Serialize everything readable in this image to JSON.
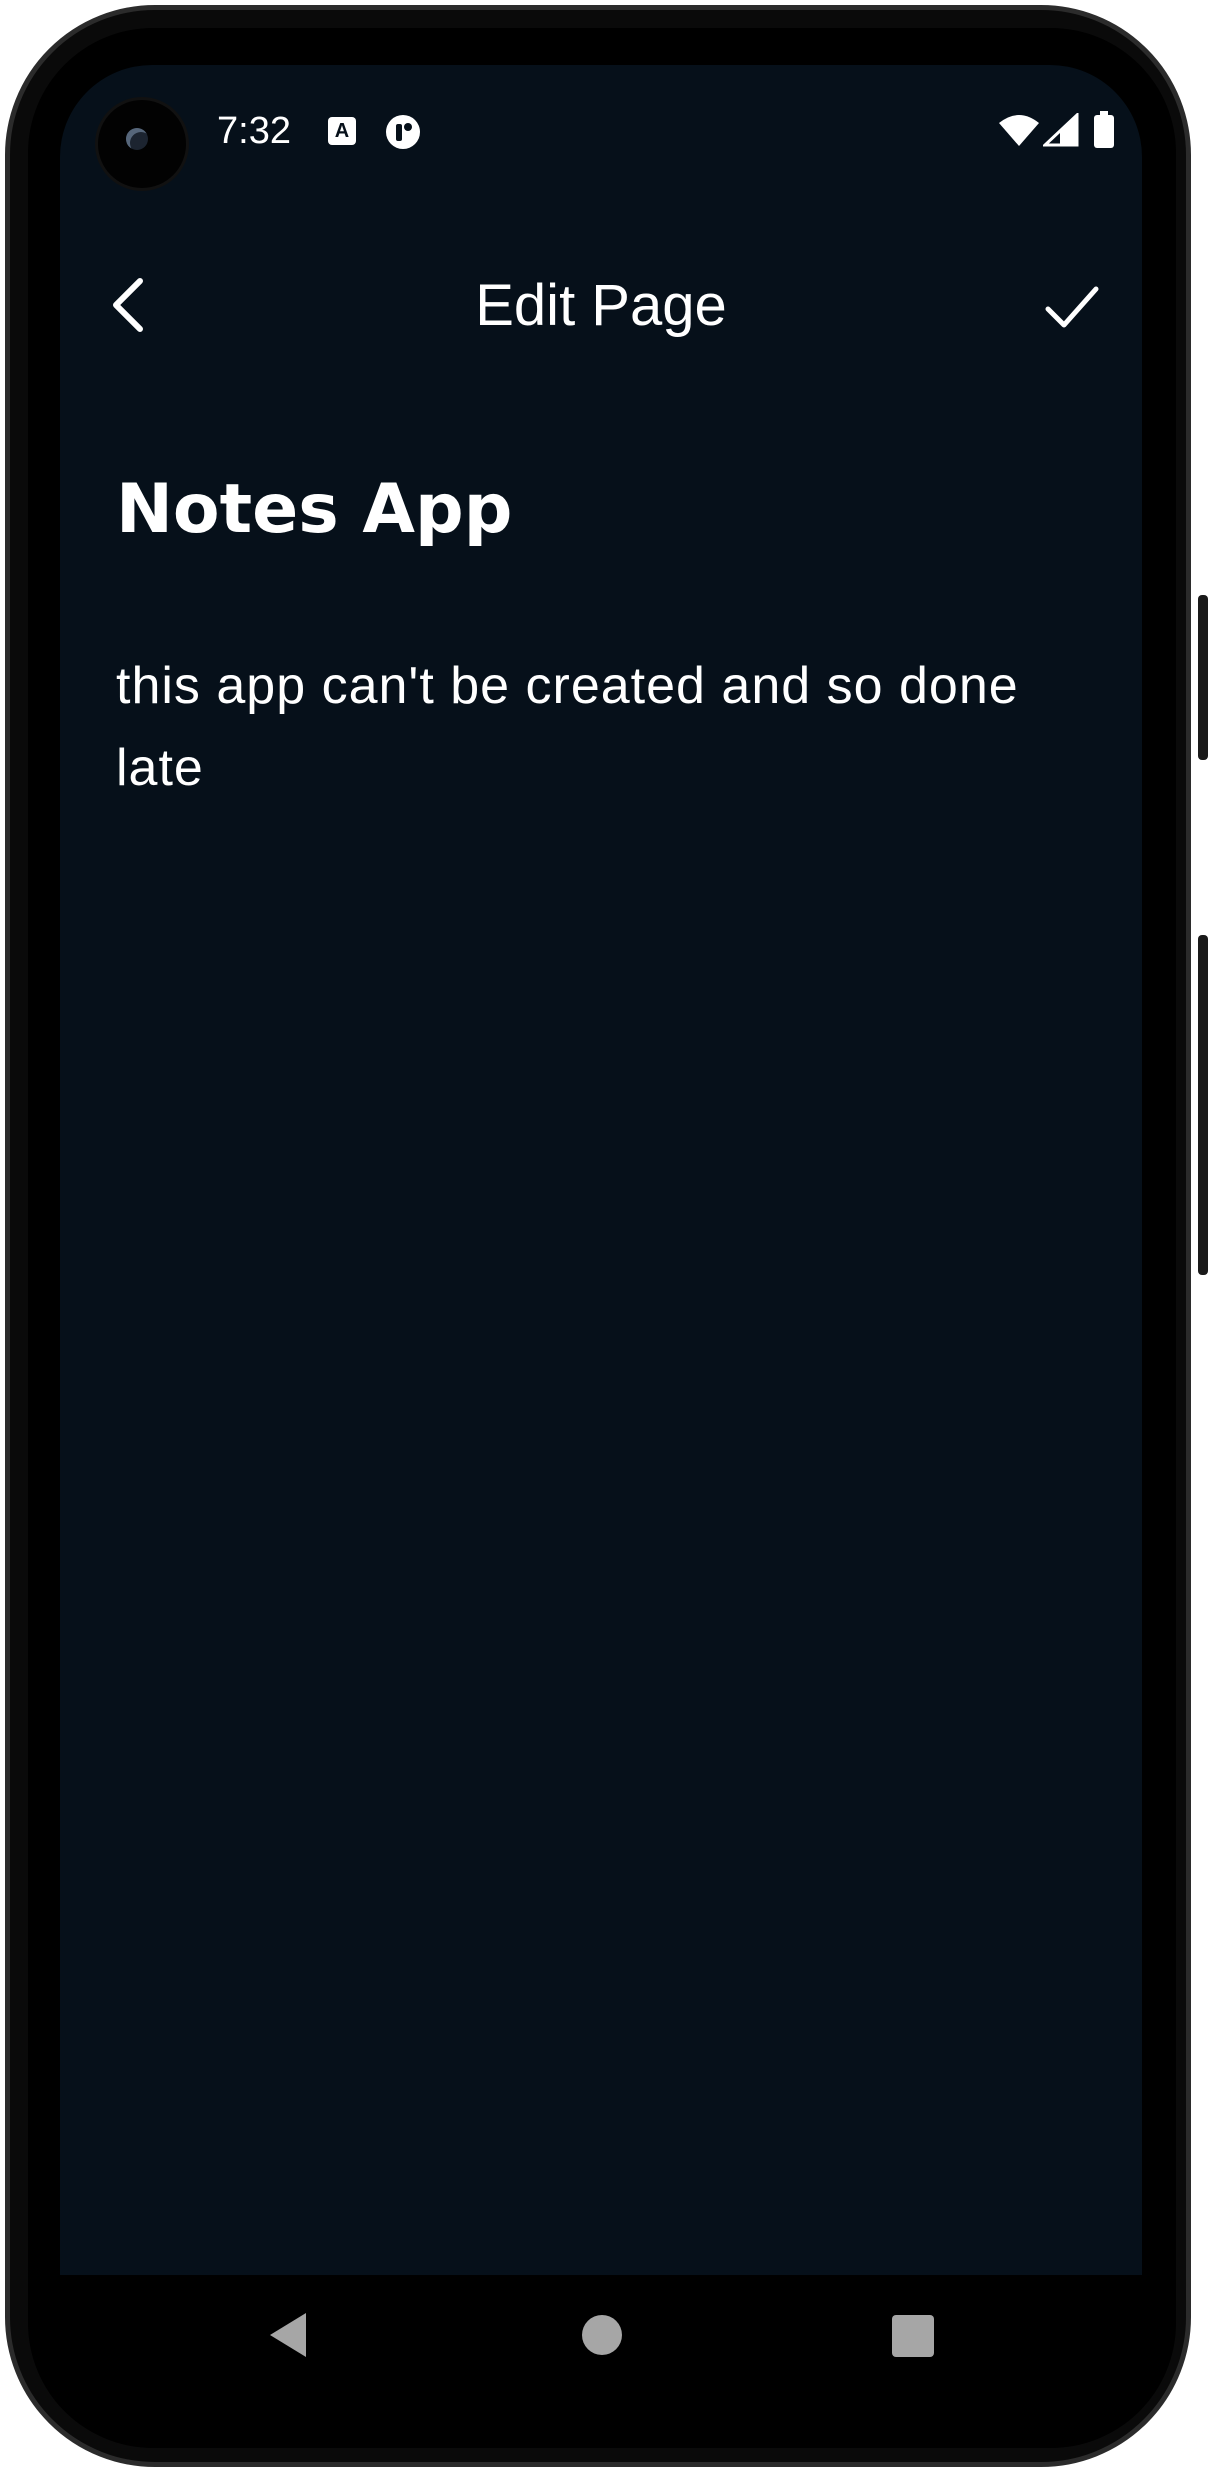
{
  "status_bar": {
    "time": "7:32",
    "notification_icons": [
      "a-badge-icon",
      "app-notification-icon"
    ],
    "system_icons": [
      "wifi-icon",
      "signal-icon",
      "battery-icon"
    ]
  },
  "app_bar": {
    "title": "Edit Page",
    "back_icon": "chevron-left-icon",
    "confirm_icon": "check-icon"
  },
  "note": {
    "title": "Notes App",
    "body": "this app can't be created and so done late"
  },
  "nav_bar": {
    "buttons": [
      "back",
      "home",
      "recents"
    ]
  },
  "colors": {
    "screen_background": "#06101a",
    "text": "#ffffff",
    "nav_buttons": "#a6a6a6"
  }
}
